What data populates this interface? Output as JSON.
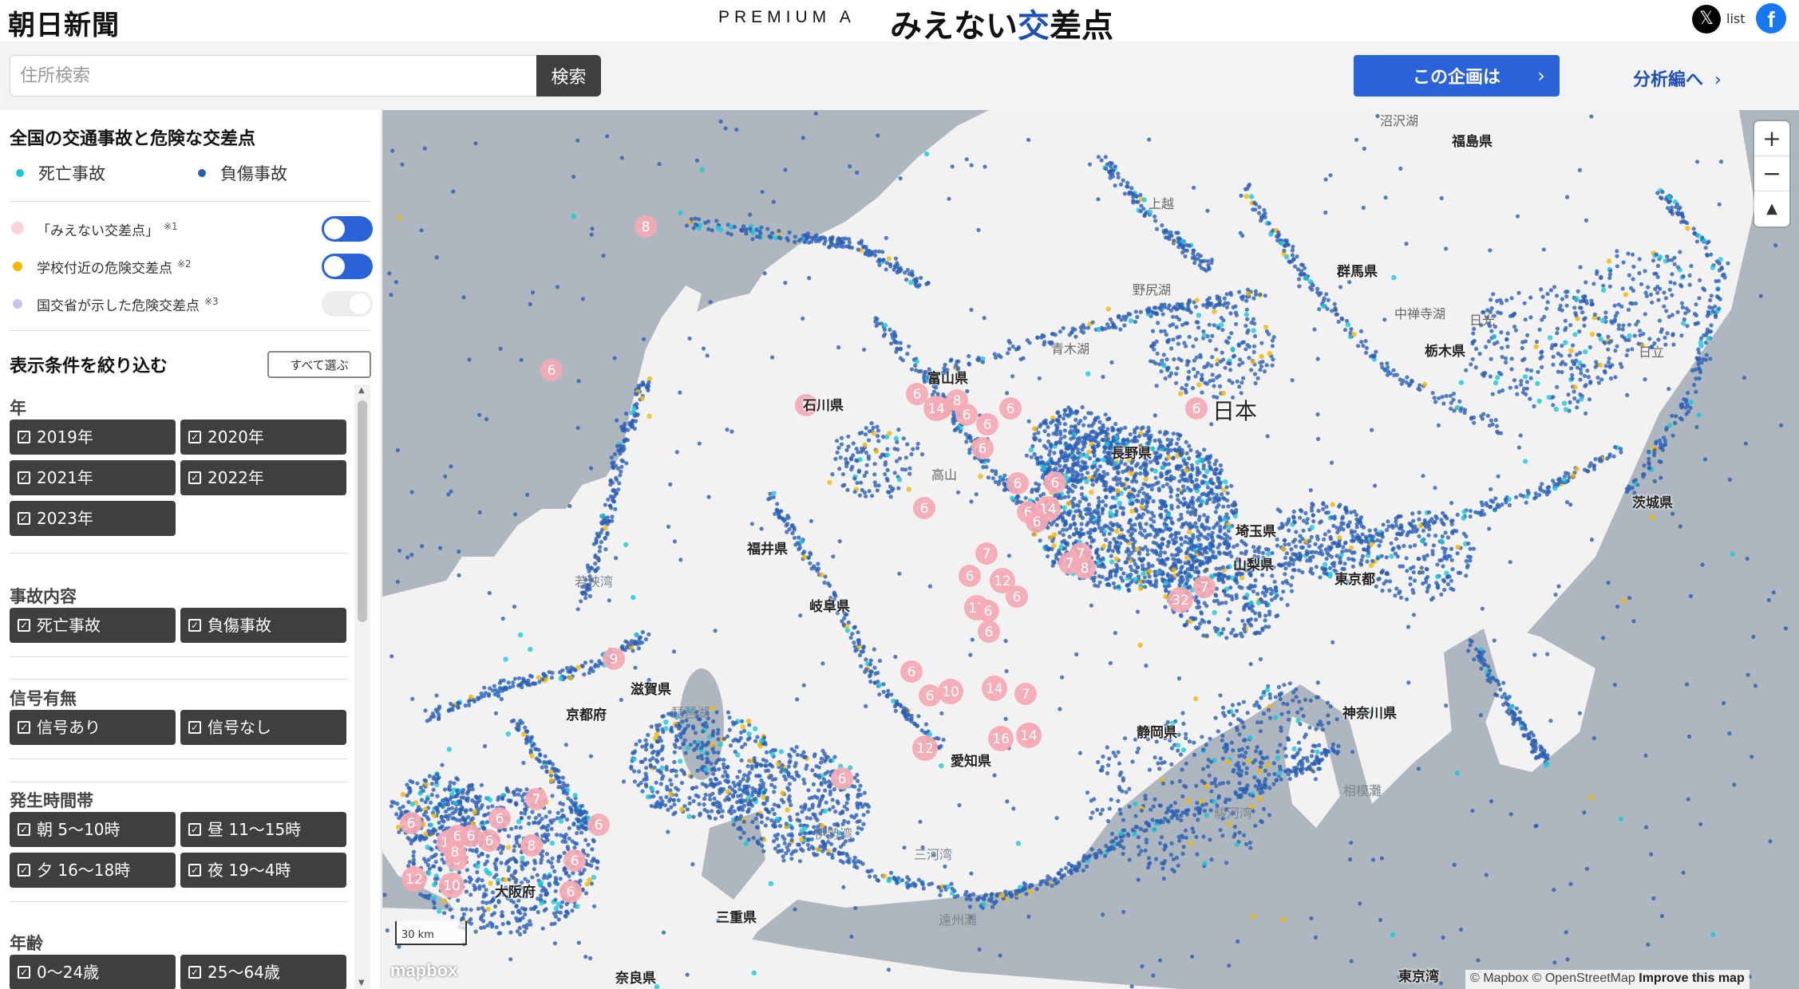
{
  "header": {
    "logo": "朝日新聞",
    "premium": "PREMIUM A",
    "title_pre": "みえない",
    "title_accent": "交",
    "title_post": "差点",
    "x_icon": "x-logo-icon",
    "list_label": "list",
    "facebook_icon": "facebook-icon"
  },
  "search": {
    "placeholder": "住所検索",
    "button_label": "検索"
  },
  "actions": {
    "about_label": "この企画は",
    "analysis_label": "分析編へ"
  },
  "sidebar": {
    "title": "全国の交通事故と危険な交差点",
    "legend": [
      {
        "label": "死亡事故",
        "color": "#1ac8d8"
      },
      {
        "label": "負傷事故",
        "color": "#2a5fb5"
      }
    ],
    "layers": [
      {
        "label": "「みえない交差点」",
        "note": "※1",
        "color": "#ffd3d8",
        "enabled": true
      },
      {
        "label": "学校付近の危険交差点",
        "note": "※2",
        "color": "#f2b705",
        "enabled": true
      },
      {
        "label": "国交省が示した危険交差点",
        "note": "※3",
        "color": "#c9c4ee",
        "enabled": false
      }
    ],
    "filter_title": "表示条件を絞り込む",
    "select_all_label": "すべて選ぶ",
    "groups": [
      {
        "title": "年",
        "chips": [
          "2019年",
          "2020年",
          "2021年",
          "2022年",
          "2023年"
        ]
      },
      {
        "title": "事故内容",
        "chips": [
          "死亡事故",
          "負傷事故"
        ]
      },
      {
        "title": "信号有無",
        "chips": [
          "信号あり",
          "信号なし"
        ]
      },
      {
        "title": "発生時間帯",
        "chips": [
          "朝 5〜10時",
          "昼 11〜15時",
          "夕 16〜18時",
          "夜 19〜4時"
        ]
      },
      {
        "title": "年齢",
        "chips": [
          "0〜24歳",
          "25〜64歳"
        ]
      }
    ]
  },
  "map": {
    "colors": {
      "sea": "#aeb7bf",
      "land": "#f2f2f2",
      "injury": "#2a5fb5",
      "fatal": "#1ac8d8",
      "school": "#f2b705",
      "cluster": "#f4a9b3"
    },
    "prefectures": [
      {
        "name": "福島県"
      },
      {
        "name": "群馬県"
      },
      {
        "name": "栃木県"
      },
      {
        "name": "茨城県"
      },
      {
        "name": "富山県"
      },
      {
        "name": "石川県"
      },
      {
        "name": "長野県"
      },
      {
        "name": "埼玉県"
      },
      {
        "name": "福井県"
      },
      {
        "name": "山梨県"
      },
      {
        "name": "東京都"
      },
      {
        "name": "岐阜県"
      },
      {
        "name": "滋賀県"
      },
      {
        "name": "京都府"
      },
      {
        "name": "愛知県"
      },
      {
        "name": "静岡県"
      },
      {
        "name": "大阪府"
      },
      {
        "name": "三重県"
      },
      {
        "name": "奈良県"
      },
      {
        "name": "神奈川県"
      }
    ],
    "country_label": "日本",
    "faint_labels": [
      {
        "name": "沼沢湖"
      },
      {
        "name": "上越"
      },
      {
        "name": "野尻湖"
      },
      {
        "name": "青木湖"
      },
      {
        "name": "中禅寺湖"
      },
      {
        "name": "日光"
      },
      {
        "name": "日立"
      },
      {
        "name": "高山"
      },
      {
        "name": "若狭湾"
      },
      {
        "name": "琵琶湖"
      },
      {
        "name": "伊勢湾"
      },
      {
        "name": "三河湾"
      },
      {
        "name": "駿河湾"
      },
      {
        "name": "相模灘"
      },
      {
        "name": "遠州灘"
      },
      {
        "name": "東京湾"
      }
    ],
    "clusters": [
      8,
      6,
      6,
      6,
      7,
      8,
      14,
      6,
      6,
      6,
      6,
      6,
      6,
      6,
      14,
      6,
      6,
      7,
      7,
      8,
      32,
      6,
      6,
      7,
      6,
      13,
      6,
      12,
      6,
      6,
      10,
      14,
      7,
      6,
      14,
      16,
      12,
      6,
      7,
      6,
      9,
      6,
      18,
      12,
      6,
      6,
      6,
      10,
      8,
      6,
      6,
      7,
      8,
      6,
      6,
      6
    ],
    "zoom_in": "+",
    "zoom_out": "−",
    "compass": "▲",
    "scale_label": "30 km",
    "mapbox_logo": "mapbox",
    "attribution": "© Mapbox © OpenStreetMap",
    "improve_link": "Improve this map"
  }
}
